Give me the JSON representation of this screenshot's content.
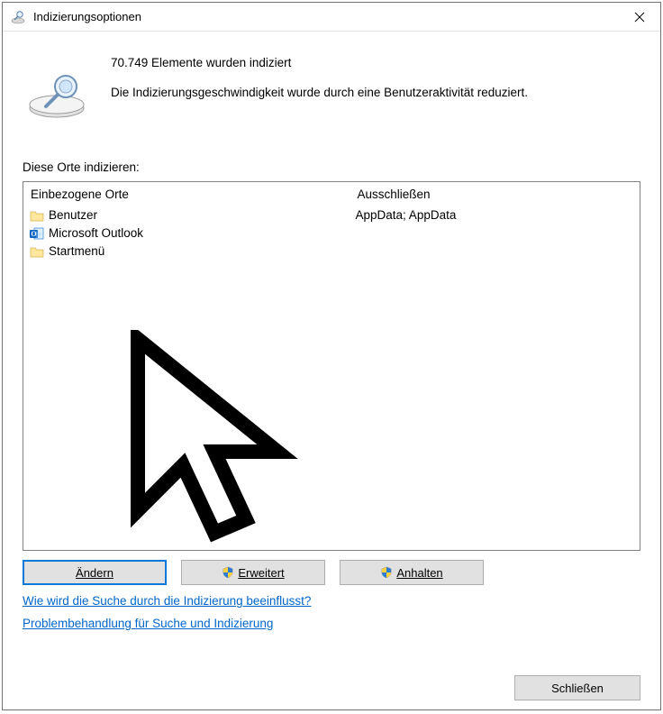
{
  "window": {
    "title": "Indizierungsoptionen"
  },
  "status": {
    "count_line": "70.749 Elemente wurden indiziert",
    "speed_line": "Die Indizierungsgeschwindigkeit wurde durch eine Benutzeraktivität reduziert."
  },
  "section_label": "Diese Orte indizieren:",
  "columns": {
    "included_header": "Einbezogene Orte",
    "excluded_header": "Ausschließen"
  },
  "included": [
    {
      "icon": "folder",
      "label": "Benutzer"
    },
    {
      "icon": "outlook",
      "label": "Microsoft Outlook"
    },
    {
      "icon": "folder",
      "label": "Startmenü"
    }
  ],
  "excluded_text": "AppData; AppData",
  "buttons": {
    "modify": "Ändern",
    "advanced": "Erweitert",
    "pause": "Anhalten",
    "close": "Schließen"
  },
  "links": {
    "how": "Wie wird die Suche durch die Indizierung beeinflusst?",
    "troubleshoot": "Problembehandlung für Suche und Indizierung"
  }
}
